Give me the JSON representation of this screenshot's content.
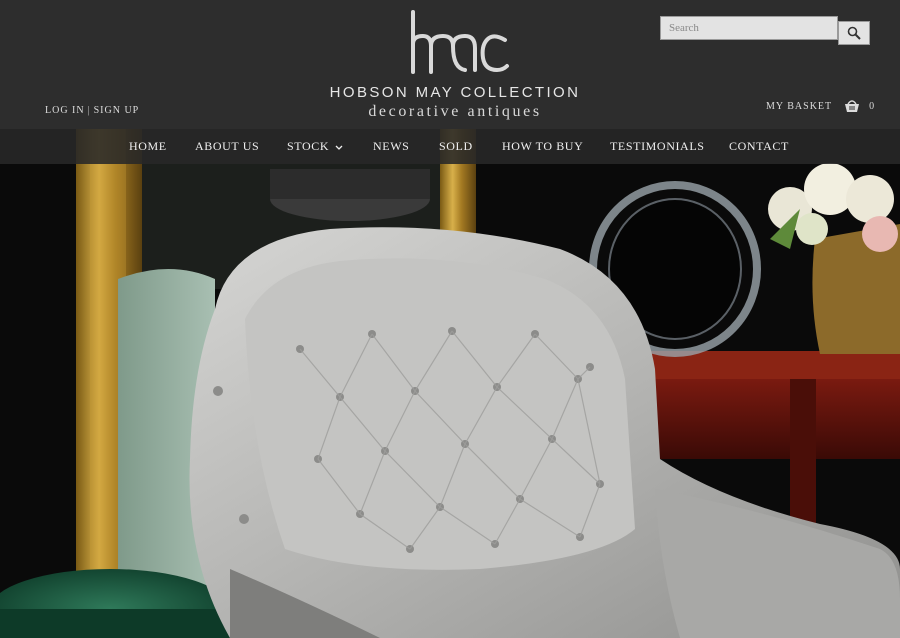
{
  "header": {
    "monogram": "hmc",
    "brand_name": "HOBSON MAY COLLECTION",
    "tagline": "decorative antiques",
    "account": {
      "login": "LOG IN",
      "separator": "|",
      "signup": "SIGN UP"
    },
    "search": {
      "placeholder": "Search",
      "icon": "search-icon"
    },
    "basket": {
      "label": "MY BASKET",
      "count": "0",
      "icon": "basket-icon"
    }
  },
  "nav": {
    "items": [
      {
        "label": "HOME"
      },
      {
        "label": "ABOUT US"
      },
      {
        "label": "STOCK",
        "dropdown": true
      },
      {
        "label": "NEWS"
      },
      {
        "label": "SOLD"
      },
      {
        "label": "HOW TO BUY"
      },
      {
        "label": "TESTIMONIALS"
      },
      {
        "label": "CONTACT"
      }
    ]
  },
  "hero": {
    "description_icon": "hero-photo"
  },
  "colors": {
    "header_bg": "#2d2d2d",
    "nav_bg": "#2a2a2a",
    "text_light": "#f0f0f0",
    "search_bg": "#e3e3e3"
  }
}
